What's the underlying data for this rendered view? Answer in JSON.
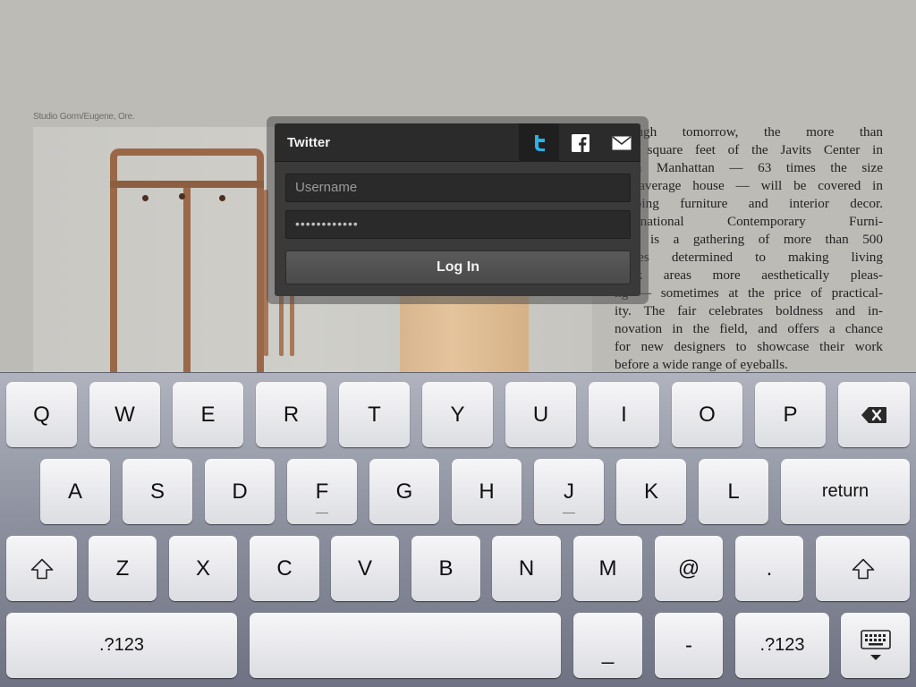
{
  "article": {
    "photo_credit": "Studio Gorm/Eugene, Ore.",
    "paragraph": [
      "through tomorrow, the more than",
      "000 square feet of the Javits Center in",
      "town Manhattan — 63 times the size",
      "he average house — will be covered in",
      "popping furniture and interior decor.",
      "International Contemporary Furni-",
      "Fair is a gathering of more than 500",
      "panies determined to making living",
      "work areas more aesthetically pleas-",
      "ng — sometimes at the price of practical-",
      "ity. The fair celebrates boldness and in-",
      "novation in the field, and offers a chance",
      "for new designers to showcase their work",
      "before a wide range of eyeballs."
    ]
  },
  "share": {
    "title": "Twitter",
    "services": [
      {
        "name": "twitter-icon",
        "active": true,
        "color": "#2ab1e6"
      },
      {
        "name": "facebook-icon",
        "active": false,
        "color": "#ffffff"
      },
      {
        "name": "mail-icon",
        "active": false,
        "color": "#ffffff"
      }
    ],
    "username_placeholder": "Username",
    "password_mask": "••••••••••••",
    "login_label": "Log In"
  },
  "keyboard": {
    "row1": [
      "Q",
      "W",
      "E",
      "R",
      "T",
      "Y",
      "U",
      "I",
      "O",
      "P"
    ],
    "row2": [
      "A",
      "S",
      "D",
      "F",
      "G",
      "H",
      "J",
      "K",
      "L"
    ],
    "return_label": "return",
    "row3": [
      "Z",
      "X",
      "C",
      "V",
      "B",
      "N",
      "M",
      "@",
      "."
    ],
    "numbers_label_left": ".?123",
    "underscore_label": "_",
    "dash_label": "-",
    "numbers_label_right": ".?123",
    "icons": {
      "backspace": "backspace-icon",
      "shift": "shift-icon",
      "dismiss": "keyboard-dismiss-icon"
    }
  }
}
